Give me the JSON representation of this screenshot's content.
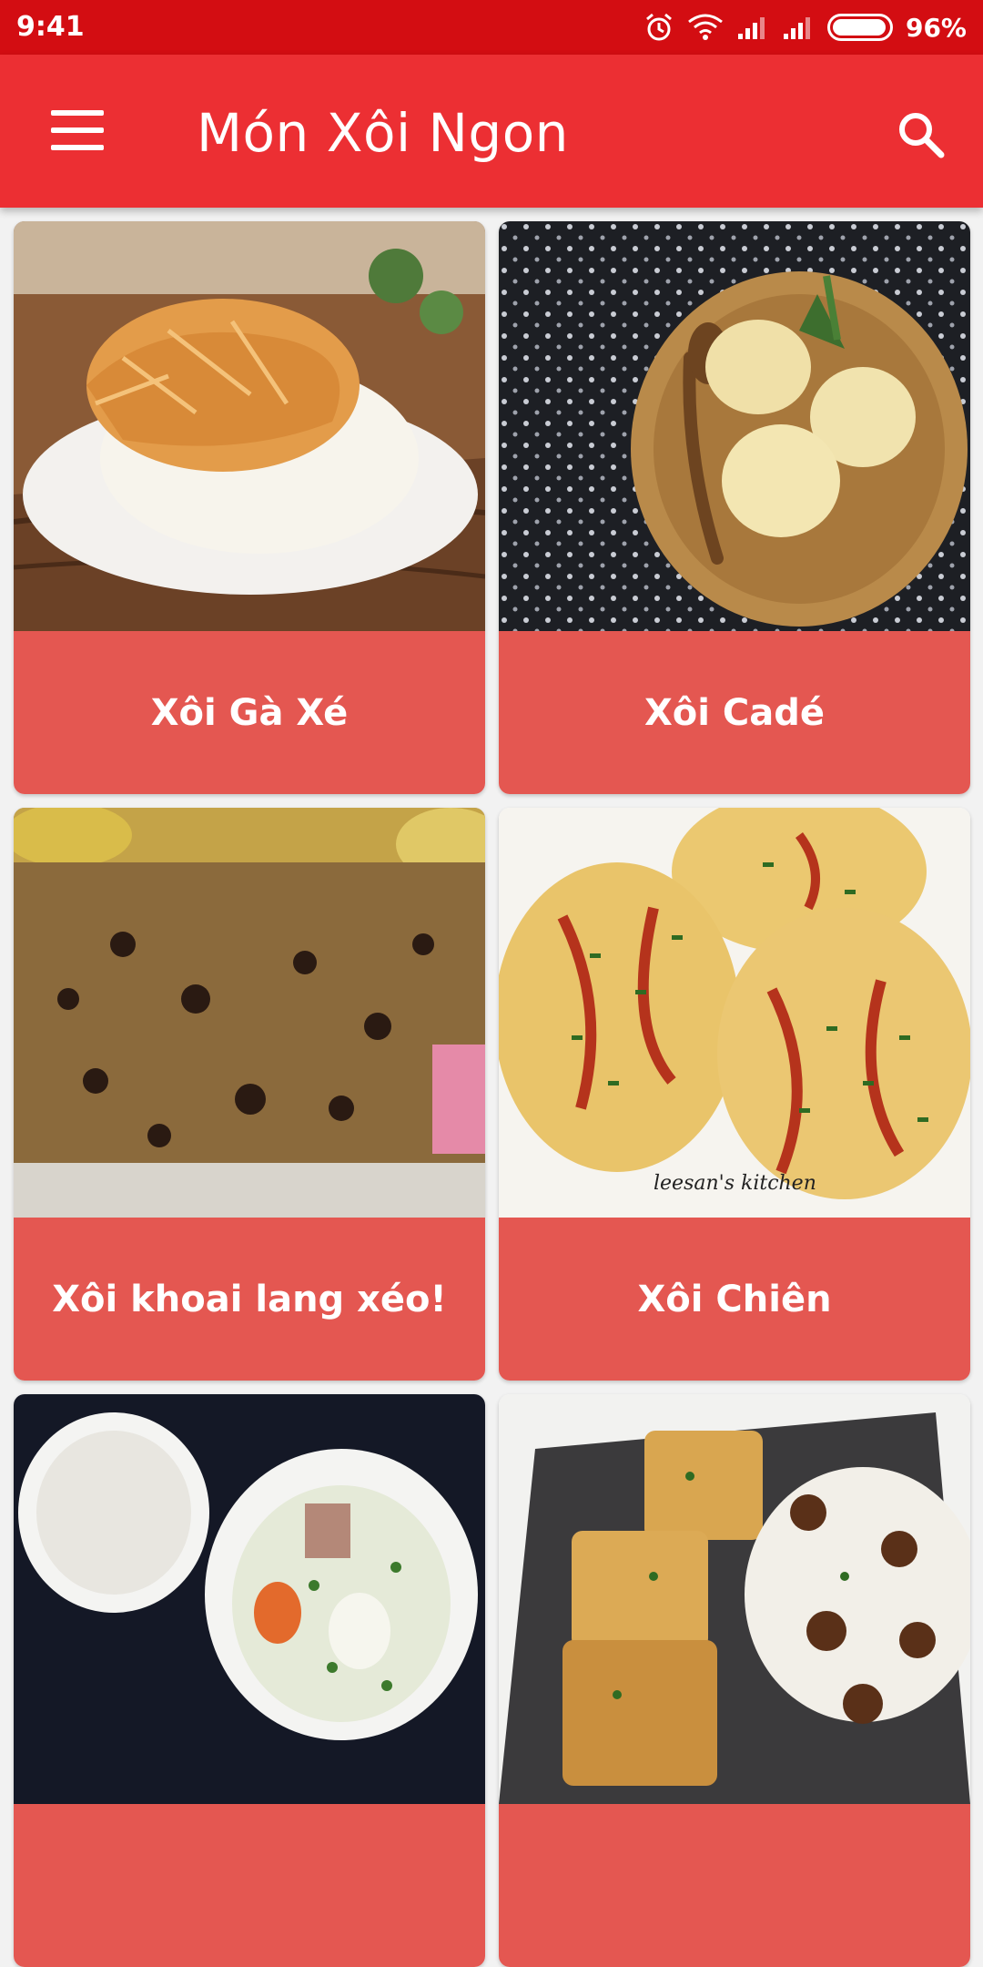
{
  "status_bar": {
    "time": "9:41",
    "battery_percent": "96%",
    "battery_level": 0.96,
    "icons": [
      "alarm-icon",
      "wifi-icon",
      "signal-icon",
      "signal-icon",
      "battery-icon"
    ]
  },
  "app_bar": {
    "title": "Món Xôi Ngon",
    "menu_icon": "hamburger-menu-icon",
    "search_icon": "search-icon"
  },
  "colors": {
    "status_bar": "#d30d12",
    "app_bar": "#ec2f33",
    "card_label": "#e45751",
    "background": "#f2f2f2"
  },
  "recipes": [
    {
      "name": "Xôi Gà Xé"
    },
    {
      "name": "Xôi Cadé"
    },
    {
      "name": "Xôi khoai lang xéo!"
    },
    {
      "name": "Xôi Chiên"
    },
    {
      "name": ""
    },
    {
      "name": ""
    }
  ],
  "watermarks": {
    "recipe_4_image": "leesan's kitchen"
  }
}
